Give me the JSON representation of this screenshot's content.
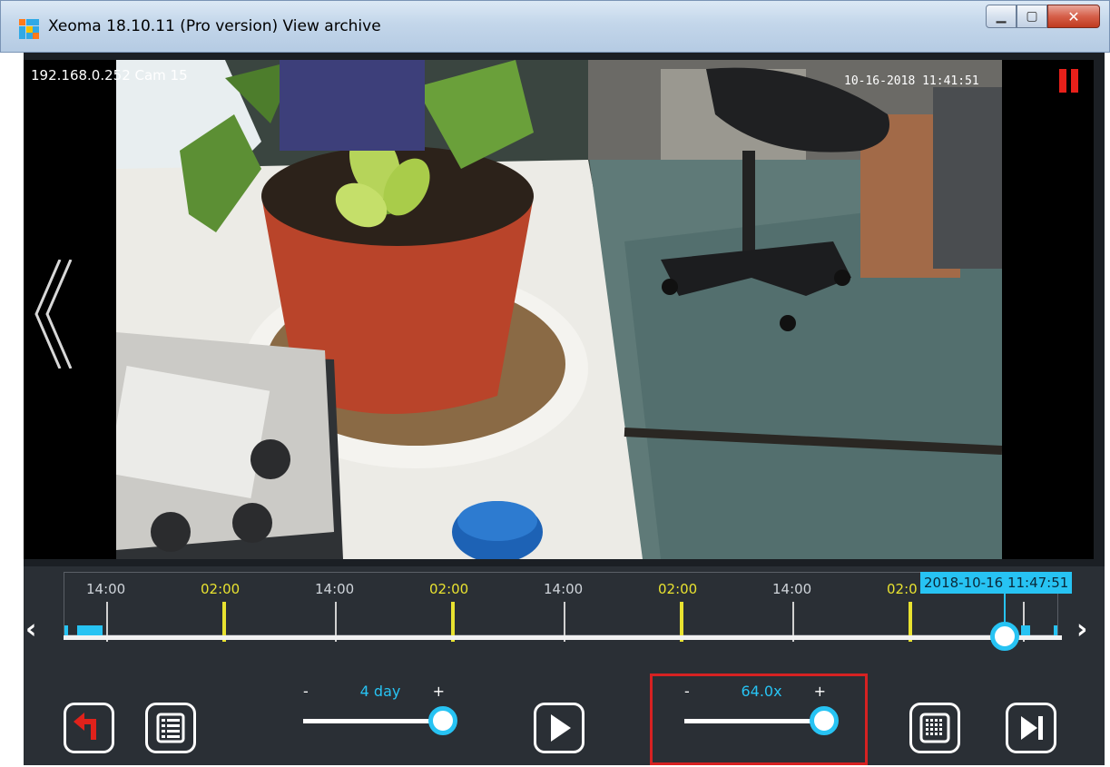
{
  "window": {
    "title": "Xeoma 18.10.11 (Pro version) View archive",
    "buttons": [
      "minimize",
      "maximize",
      "close"
    ]
  },
  "video": {
    "camera_label": "192.168.0.252 Cam 15",
    "timestamp": "10-16-2018 11:41:51",
    "status_icon": "pause-icon",
    "left_nav_icon": "double-chevron-left-icon"
  },
  "timeline": {
    "labels": [
      {
        "text": "14:00",
        "color": "#cfd4da"
      },
      {
        "text": "02:00",
        "color": "#e8e230"
      },
      {
        "text": "14:00",
        "color": "#cfd4da"
      },
      {
        "text": "02:00",
        "color": "#e8e230"
      },
      {
        "text": "14:00",
        "color": "#cfd4da"
      },
      {
        "text": "02:00",
        "color": "#e8e230"
      },
      {
        "text": "14:00",
        "color": "#cfd4da"
      },
      {
        "text": "02:0",
        "color": "#e8e230"
      }
    ],
    "current_time": "2018-10-16 11:47:51",
    "position_fraction": 0.98,
    "prev_icon": "chevron-left-icon",
    "next_icon": "chevron-right-icon"
  },
  "controls": {
    "back_icon": "undo-arrow-icon",
    "list_icon": "list-icon",
    "scale": {
      "minus": "-",
      "plus": "+",
      "value": "4 day",
      "fraction": 1.0
    },
    "play_icon": "play-icon",
    "speed": {
      "minus": "-",
      "plus": "+",
      "value": "64.0x",
      "fraction": 1.0
    },
    "grid_icon": "grid-icon",
    "skip_icon": "skip-to-end-icon"
  },
  "colors": {
    "accent": "#27c3f3",
    "marker_yellow": "#e8e230",
    "highlight_border": "#d62222",
    "undo_red": "#e0221b"
  }
}
